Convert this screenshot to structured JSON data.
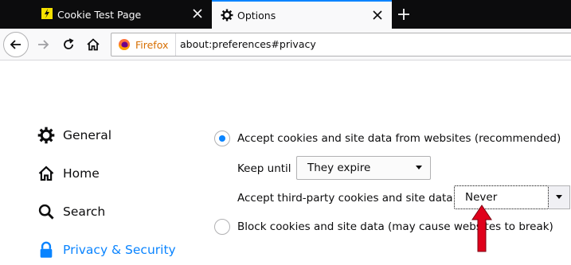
{
  "tabs": [
    {
      "title": "Cookie Test Page",
      "active": false
    },
    {
      "title": "Options",
      "active": true
    }
  ],
  "navbar": {
    "identity_label": "Firefox",
    "url": "about:preferences#privacy"
  },
  "sidebar": {
    "items": [
      {
        "label": "General",
        "icon": "gear-icon",
        "selected": false
      },
      {
        "label": "Home",
        "icon": "home-icon",
        "selected": false
      },
      {
        "label": "Search",
        "icon": "search-icon",
        "selected": false
      },
      {
        "label": "Privacy & Security",
        "icon": "lock-icon",
        "selected": true
      }
    ]
  },
  "cookies": {
    "accept_label": "Accept cookies and site data from websites (recommended)",
    "accept_selected": true,
    "keep_until_label": "Keep until",
    "keep_until_value": "They expire",
    "third_party_label": "Accept third-party cookies and site data",
    "third_party_value": "Never",
    "block_label": "Block cookies and site data (may cause websites to break)",
    "block_selected": false
  },
  "colors": {
    "accent": "#0a84ff",
    "tabstrip": "#0c0c0d",
    "firefox_label": "#d76e00",
    "annotation_arrow": "#e0001b"
  }
}
